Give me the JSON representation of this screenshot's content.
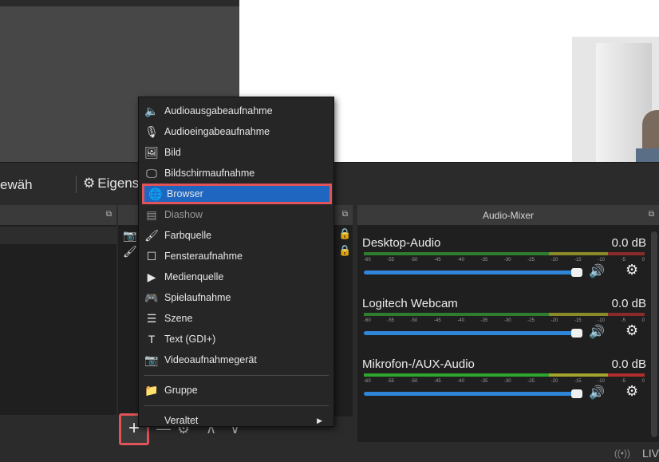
{
  "toolbar": {
    "left_label": "ewäh",
    "properties_label": "Eigens"
  },
  "docks": {
    "mixer_title": "Audio-Mixer"
  },
  "mixer": {
    "ticks": [
      "-60",
      "-55",
      "-50",
      "-45",
      "-40",
      "-35",
      "-30",
      "-25",
      "-20",
      "-15",
      "-10",
      "-5",
      "0"
    ],
    "channels": [
      {
        "name": "Desktop-Audio",
        "db": "0.0 dB",
        "level": 0.0
      },
      {
        "name": "Logitech Webcam",
        "db": "0.0 dB",
        "level": 0.0
      },
      {
        "name": "Mikrofon-/AUX-Audio",
        "db": "0.0 dB",
        "level": 0.0
      }
    ]
  },
  "menu": {
    "items": [
      {
        "label": "Audioausgabeaufnahme",
        "icon": "speaker-icon",
        "glyph": "🔈"
      },
      {
        "label": "Audioeingabeaufnahme",
        "icon": "microphone-icon",
        "glyph": "🎙"
      },
      {
        "label": "Bild",
        "icon": "image-icon",
        "glyph": "🖼"
      },
      {
        "label": "Bildschirmaufnahme",
        "icon": "monitor-icon",
        "glyph": "🖵"
      },
      {
        "label": "Browser",
        "icon": "globe-icon",
        "glyph": "🌐"
      },
      {
        "label": "Diashow",
        "icon": "slideshow-icon",
        "glyph": "▤"
      },
      {
        "label": "Farbquelle",
        "icon": "brush-icon",
        "glyph": "🖌"
      },
      {
        "label": "Fensteraufnahme",
        "icon": "window-icon",
        "glyph": "☐"
      },
      {
        "label": "Medienquelle",
        "icon": "play-icon",
        "glyph": "▶"
      },
      {
        "label": "Spielaufnahme",
        "icon": "gamepad-icon",
        "glyph": "🎮"
      },
      {
        "label": "Szene",
        "icon": "list-icon",
        "glyph": "☰"
      },
      {
        "label": "Text (GDI+)",
        "icon": "text-icon",
        "glyph": "T"
      },
      {
        "label": "Videoaufnahmegerät",
        "icon": "camera-icon",
        "glyph": "📷"
      },
      {
        "label": "Gruppe",
        "icon": "folder-icon",
        "glyph": "📁"
      },
      {
        "label": "Veraltet",
        "icon": "",
        "glyph": "",
        "submenu": true
      }
    ],
    "highlighted": "Browser"
  },
  "bottom_controls": {
    "add": "+",
    "remove": "—",
    "settings": "⚙",
    "up": "∧",
    "down": "∨"
  },
  "status": {
    "live_label": "LIV"
  },
  "colors": {
    "highlight": "#1f66c0",
    "annotation_border": "#e05358",
    "slider": "#2f86d8"
  }
}
